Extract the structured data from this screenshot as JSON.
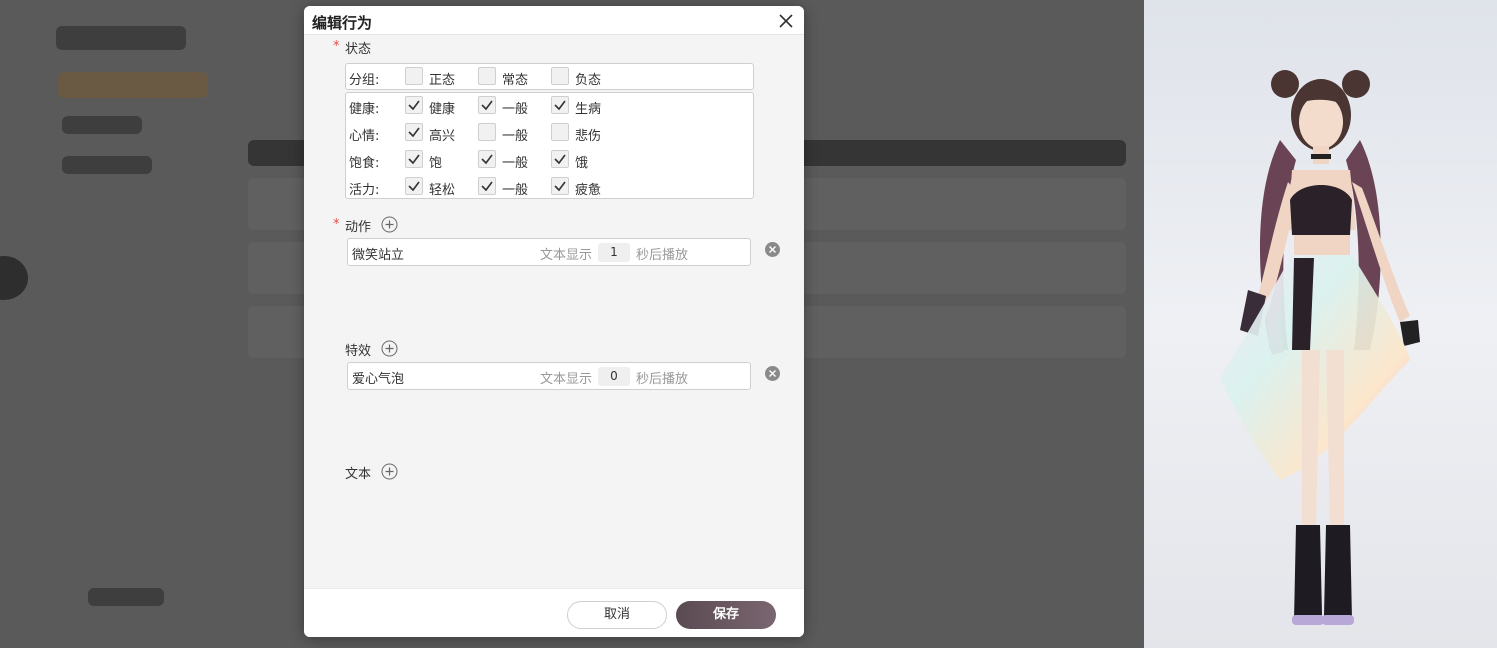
{
  "dialog": {
    "title": "编辑行为",
    "cancel_label": "取消",
    "save_label": "保存"
  },
  "status": {
    "label": "状态",
    "group": {
      "label": "分组:",
      "options": [
        {
          "label": "正态",
          "checked": false
        },
        {
          "label": "常态",
          "checked": false
        },
        {
          "label": "负态",
          "checked": false
        }
      ]
    },
    "rows": [
      {
        "label": "健康:",
        "options": [
          {
            "label": "健康",
            "checked": true
          },
          {
            "label": "一般",
            "checked": true
          },
          {
            "label": "生病",
            "checked": true
          }
        ]
      },
      {
        "label": "心情:",
        "options": [
          {
            "label": "高兴",
            "checked": true
          },
          {
            "label": "一般",
            "checked": false
          },
          {
            "label": "悲伤",
            "checked": false
          }
        ]
      },
      {
        "label": "饱食:",
        "options": [
          {
            "label": "饱",
            "checked": true
          },
          {
            "label": "一般",
            "checked": true
          },
          {
            "label": "饿",
            "checked": true
          }
        ]
      },
      {
        "label": "活力:",
        "options": [
          {
            "label": "轻松",
            "checked": true
          },
          {
            "label": "一般",
            "checked": true
          },
          {
            "label": "疲惫",
            "checked": true
          }
        ]
      }
    ]
  },
  "action": {
    "label": "动作",
    "items": [
      {
        "name": "微笑站立",
        "text_show_label": "文本显示",
        "seconds": "1",
        "after_label": "秒后播放"
      }
    ]
  },
  "effect": {
    "label": "特效",
    "items": [
      {
        "name": "爱心气泡",
        "text_show_label": "文本显示",
        "seconds": "0",
        "after_label": "秒后播放"
      }
    ]
  },
  "text_section": {
    "label": "文本"
  },
  "colors": {
    "required": "#e05050",
    "save_button": "#6a5860"
  }
}
